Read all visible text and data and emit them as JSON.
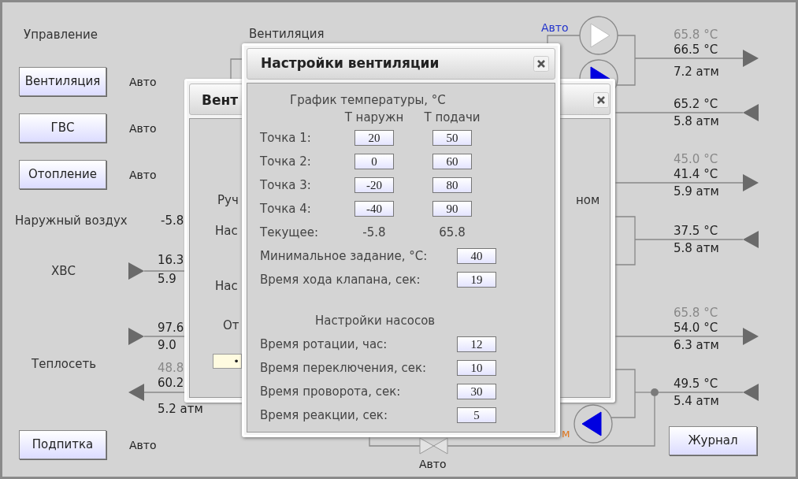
{
  "control_panel": {
    "title": "Управление",
    "units": [
      {
        "label": "Вентиляция",
        "mode": "Авто"
      },
      {
        "label": "ГВС",
        "mode": "Авто"
      },
      {
        "label": "Отопление",
        "mode": "Авто"
      }
    ]
  },
  "outdoor_air": {
    "label": "Наружный воздух",
    "value": "-5.8"
  },
  "cold_water": {
    "label": "ХВС",
    "temperature": "16.3",
    "pressure": "5.9"
  },
  "heat_network": {
    "label": "Теплосеть",
    "supply_temperature": "97.6",
    "supply_pressure": "9.0",
    "setpoint": "48.8",
    "return_temperature": "60.2",
    "return_pressure": "5.2 атм"
  },
  "makeup": {
    "label": "Подпитка",
    "mode": "Авто"
  },
  "ventilation_label": "Вентиляция",
  "pump_mode": "Авто",
  "pumps": [
    {
      "running": false
    },
    {
      "running": true
    },
    {
      "running": true
    }
  ],
  "valve_mode": "Авто",
  "orange_text": "м",
  "circuits": [
    {
      "setpoint": "65.8 °C",
      "temperature": "66.5 °C",
      "pressure": "7.2 атм",
      "outgoing": true
    },
    {
      "temperature": "65.2 °C",
      "pressure": "5.8 атм",
      "outgoing": false
    },
    {
      "setpoint": "45.0 °C",
      "temperature": "41.4 °C",
      "pressure": "5.9 атм",
      "outgoing": true
    },
    {
      "temperature": "37.5 °C",
      "pressure": "5.8 атм",
      "outgoing": false
    },
    {
      "setpoint": "65.8 °C",
      "temperature": "54.0 °C",
      "pressure": "6.3 атм",
      "outgoing": true
    },
    {
      "temperature": "49.5 °C",
      "pressure": "5.4 атм",
      "outgoing": false
    }
  ],
  "journal_button": "Журнал",
  "back_dialog": {
    "title": "Вент",
    "labels": [
      "Руч",
      "Нас",
      "Нас",
      "От"
    ],
    "right_label": "ном",
    "field_value": "•"
  },
  "settings_dialog": {
    "title": "Настройки вентиляции",
    "schedule_title": "График температуры, °C",
    "columns": [
      "Т наружн",
      "Т подачи"
    ],
    "points": [
      {
        "label": "Точка 1:",
        "outdoor": "20",
        "supply": "50"
      },
      {
        "label": "Точка 2:",
        "outdoor": "0",
        "supply": "60"
      },
      {
        "label": "Точка 3:",
        "outdoor": "-20",
        "supply": "80"
      },
      {
        "label": "Точка 4:",
        "outdoor": "-40",
        "supply": "90"
      }
    ],
    "current": {
      "label": "Текущее:",
      "outdoor": "-5.8",
      "supply": "65.8"
    },
    "settings": [
      {
        "label": "Минимальное задание, °C:",
        "value": "40"
      },
      {
        "label": "Время хода клапана, сек:",
        "value": "19"
      }
    ],
    "pumps_title": "Настройки насосов",
    "pump_settings": [
      {
        "label": "Время ротации, час:",
        "value": "12"
      },
      {
        "label": "Время переключения, сек:",
        "value": "10"
      },
      {
        "label": "Время проворота, сек:",
        "value": "30"
      },
      {
        "label": "Время реакции, сек:",
        "value": "5"
      }
    ]
  }
}
